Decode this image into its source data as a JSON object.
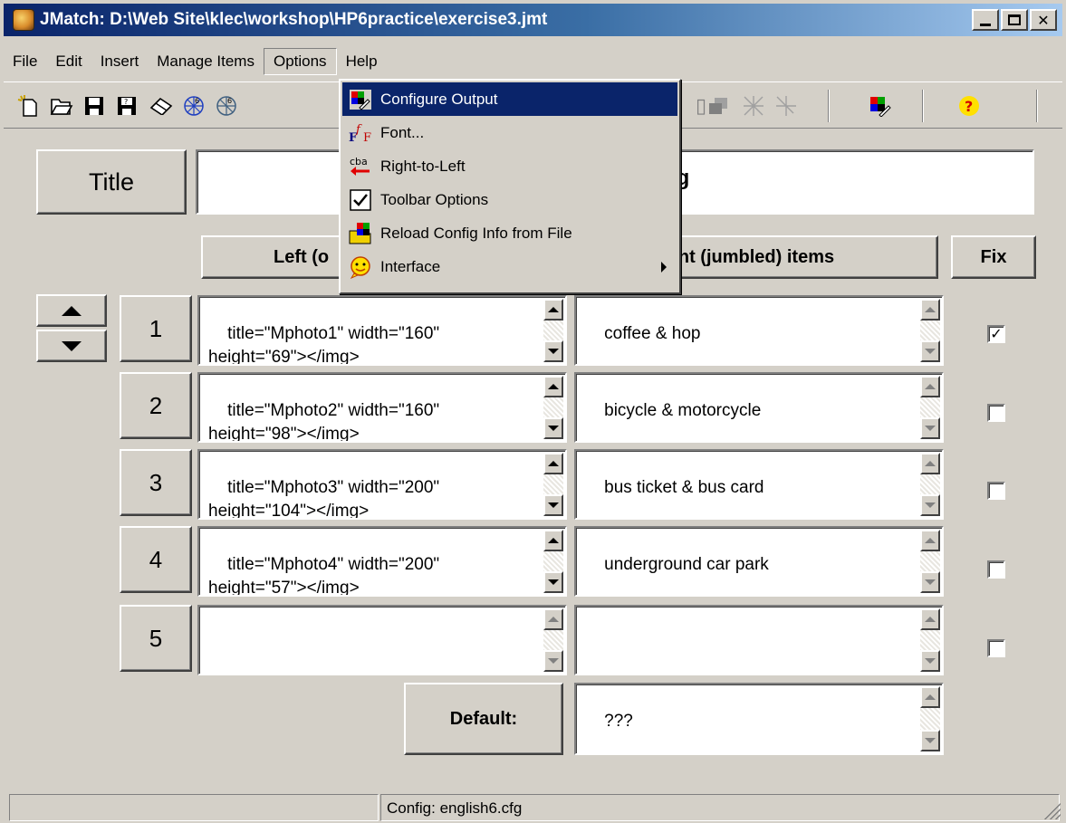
{
  "window": {
    "title": "JMatch: D:\\Web Site\\klec\\workshop\\HP6practice\\exercise3.jmt"
  },
  "menu": [
    "File",
    "Edit",
    "Insert",
    "Manage Items",
    "Options",
    "Help"
  ],
  "options_menu": {
    "items": [
      {
        "label": "Configure Output",
        "icon": "configure-output-icon"
      },
      {
        "label": "Font...",
        "icon": "font-icon"
      },
      {
        "label": "Right-to-Left",
        "icon": "right-to-left-icon"
      },
      {
        "label": "Toolbar Options",
        "icon": "toolbar-options-icon"
      },
      {
        "label": "Reload Config Info from File",
        "icon": "reload-config-icon"
      },
      {
        "label": "Interface",
        "icon": "interface-icon"
      }
    ]
  },
  "exercise": {
    "title_label": "Title",
    "title_value": "arning",
    "left_header": "Left (o",
    "right_header": "nt (jumbled) items",
    "fix_header": "Fix",
    "rows": [
      {
        "num": "1",
        "left": "title=\"Mphoto1\" width=\"160\"\nheight=\"69\"></img>",
        "right": "coffee & hop",
        "fixed": true
      },
      {
        "num": "2",
        "left": "title=\"Mphoto2\" width=\"160\"\nheight=\"98\"></img>",
        "right": "bicycle & motorcycle",
        "fixed": false
      },
      {
        "num": "3",
        "left": "title=\"Mphoto3\" width=\"200\"\nheight=\"104\"></img>",
        "right": "bus ticket & bus card",
        "fixed": false
      },
      {
        "num": "4",
        "left": "title=\"Mphoto4\" width=\"200\"\nheight=\"57\"></img>",
        "right": "underground car park",
        "fixed": false
      },
      {
        "num": "5",
        "left": "",
        "right": "",
        "fixed": false
      }
    ],
    "default_label": "Default:",
    "default_value": "???"
  },
  "status": {
    "pane1": "",
    "config": "Config: english6.cfg"
  },
  "colors": {
    "titlebar": "#0a246a",
    "highlight": "#0a246a",
    "face": "#d4d0c8"
  }
}
